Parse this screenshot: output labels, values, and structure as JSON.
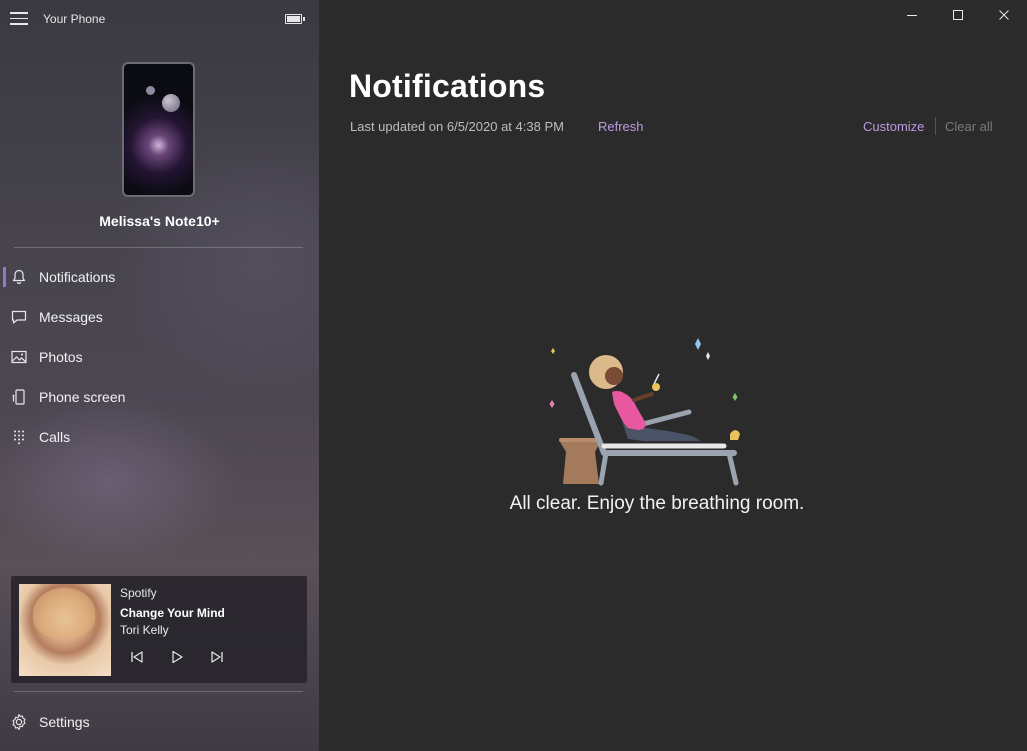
{
  "app": {
    "title": "Your Phone"
  },
  "device": {
    "name": "Melissa's Note10+"
  },
  "nav": {
    "items": [
      {
        "label": "Notifications",
        "icon": "bell-icon",
        "active": true
      },
      {
        "label": "Messages",
        "icon": "message-icon",
        "active": false
      },
      {
        "label": "Photos",
        "icon": "photos-icon",
        "active": false
      },
      {
        "label": "Phone screen",
        "icon": "phone-screen-icon",
        "active": false
      },
      {
        "label": "Calls",
        "icon": "dialpad-icon",
        "active": false
      }
    ],
    "settings_label": "Settings"
  },
  "media": {
    "source": "Spotify",
    "track": "Change Your Mind",
    "artist": "Tori Kelly"
  },
  "main": {
    "title": "Notifications",
    "last_updated": "Last updated on 6/5/2020 at 4:38 PM",
    "refresh_label": "Refresh",
    "customize_label": "Customize",
    "clear_all_label": "Clear all",
    "empty_message": "All clear. Enjoy the breathing room."
  },
  "colors": {
    "accent": "#b99be0",
    "background": "#2b2b2b",
    "active_indicator": "#8e7cc3",
    "disabled_text": "#7a7a7a"
  }
}
